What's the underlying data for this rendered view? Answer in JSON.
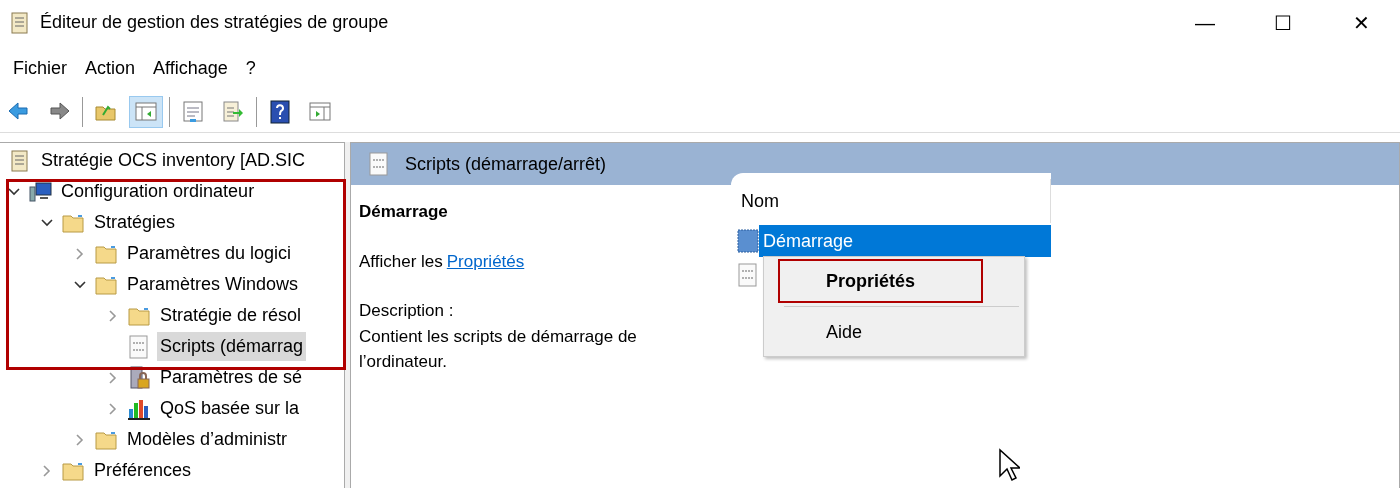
{
  "window": {
    "title": "Éditeur de gestion des stratégies de groupe",
    "controls": [
      "—",
      "☐",
      "✕"
    ]
  },
  "menu": [
    {
      "label": "Fichier"
    },
    {
      "label": "Action"
    },
    {
      "label": "Affichage"
    },
    {
      "label": "?"
    }
  ],
  "toolbar": [
    {
      "selected": false
    },
    {
      "selected": false
    },
    {
      "selected": false
    },
    {
      "selected": true
    },
    {
      "selected": false
    },
    {
      "selected": false
    },
    {
      "selected": false
    },
    {
      "selected": false
    }
  ],
  "tree": [
    {
      "label": "Stratégie OCS inventory [AD.SIC",
      "kind": "policy",
      "selected": false,
      "children": [
        {
          "label": "Configuration ordinateur",
          "kind": "computer",
          "expanded": true,
          "selected": false,
          "children": [
            {
              "label": "Stratégies",
              "kind": "folder",
              "expanded": true,
              "selected": false,
              "children": [
                {
                  "label": "Paramètres du logici",
                  "kind": "folder",
                  "expanded": false,
                  "selected": false
                },
                {
                  "label": "Paramètres Windows",
                  "kind": "folder",
                  "expanded": true,
                  "selected": false,
                  "children": [
                    {
                      "label": "Stratégie de résol",
                      "kind": "folder",
                      "expanded": false,
                      "selected": false
                    },
                    {
                      "label": "Scripts (démarrag",
                      "kind": "script",
                      "selected": true
                    },
                    {
                      "label": "Paramètres de sé",
                      "kind": "security",
                      "expanded": false,
                      "selected": false
                    },
                    {
                      "label": "QoS basée sur la",
                      "kind": "qos",
                      "expanded": false,
                      "selected": false
                    }
                  ]
                },
                {
                  "label": "Modèles d’administr",
                  "kind": "folder",
                  "expanded": false,
                  "selected": false
                }
              ]
            },
            {
              "label": "Préférences",
              "kind": "folder",
              "expanded": false,
              "selected": false
            }
          ]
        }
      ]
    }
  ],
  "details": {
    "header": "Scripts (démarrage/arrêt)",
    "heading": "Démarrage",
    "link_prefix": "Afficher les",
    "link": "Propriétés",
    "description_label": "Description :",
    "description": "Contient les scripts de démarrage de l’ordinateur."
  },
  "list": {
    "columns": [
      "Nom"
    ],
    "rows": [
      {
        "name": "Démarrage",
        "selected": true
      },
      {
        "selected": false
      }
    ]
  },
  "context_menu": [
    {
      "label": "Propriétés",
      "bold": true
    },
    {
      "label": "Aide",
      "bold": false
    }
  ]
}
